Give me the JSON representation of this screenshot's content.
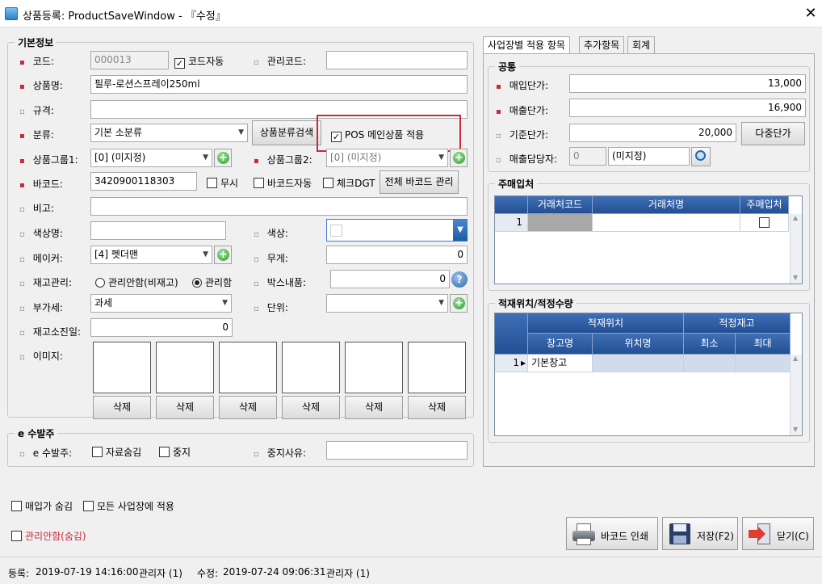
{
  "window": {
    "title": "상품등록: ProductSaveWindow - 『수정』"
  },
  "basic": {
    "legend": "기본정보",
    "code_label": "코드:",
    "code_value": "000013",
    "code_auto": "코드자동",
    "mgmt_code_label": "관리코드:",
    "mgmt_code_value": "",
    "name_label": "상품명:",
    "name_value": "필루-로션스프레이250ml",
    "spec_label": "규격:",
    "spec_value": "",
    "class_label": "분류:",
    "class_value": "기본 소분류",
    "class_search": "상품분류검색",
    "pos_main": "POS 메인상품 적용",
    "group1_label": "상품그룹1:",
    "group1_value": "[0] (미지정)",
    "group2_label": "상품그룹2:",
    "group2_value": "[0] (미지정)",
    "barcode_label": "바코드:",
    "barcode_value": "3420900118303",
    "ignore": "무시",
    "barcode_auto": "바코드자동",
    "check_dgt": "체크DGT",
    "barcode_manage": "전체 바코드 관리",
    "note_label": "비고:",
    "note_value": "",
    "color_name_label": "색상명:",
    "color_name_value": "",
    "color_label": "색상:",
    "maker_label": "메이커:",
    "maker_value": "[4] 펫더맨",
    "weight_label": "무게:",
    "weight_value": "0",
    "stock_label": "재고관리:",
    "stock_opt1": "관리안함(비재고)",
    "stock_opt2": "관리함",
    "box_label": "박스내품:",
    "box_value": "0",
    "vat_label": "부가세:",
    "vat_value": "과세",
    "unit_label": "단위:",
    "unit_value": "",
    "stockout_label": "재고소진일:",
    "stockout_value": "0",
    "image_label": "이미지:",
    "delete_buttons": [
      "삭제",
      "삭제",
      "삭제",
      "삭제",
      "삭제",
      "삭제"
    ]
  },
  "eorder": {
    "legend": "e 수발주",
    "label": "e 수발주:",
    "hide": "자료숨김",
    "stop": "중지",
    "stop_reason_label": "중지사유:",
    "stop_reason_value": ""
  },
  "bottom": {
    "hide_buy": "매입가 숨김",
    "apply_all": "모든 사업장에 적용",
    "no_manage": "관리안함(숨김)"
  },
  "tabs": [
    "사업장별 적용 항목",
    "추가항목",
    "회계"
  ],
  "common": {
    "legend": "공통",
    "buy_label": "매입단가:",
    "buy_value": "13,000",
    "sell_label": "매출단가:",
    "sell_value": "16,900",
    "base_label": "기준단가:",
    "base_value": "20,000",
    "multi_price": "다중단가",
    "manager_label": "매출담당자:",
    "manager_code": "0",
    "manager_value": "(미지정)"
  },
  "supplier": {
    "legend": "주매입처",
    "headers": [
      "거래처코드",
      "거래처명",
      "주매입처"
    ],
    "rows": [
      {
        "no": "1",
        "code": "",
        "name": ""
      }
    ]
  },
  "location": {
    "legend": "적재위치/적정수량",
    "group_headers": [
      "적재위치",
      "적정재고"
    ],
    "headers": [
      "창고명",
      "위치명",
      "최소",
      "최대"
    ],
    "rows": [
      {
        "no": "1",
        "warehouse": "기본창고",
        "location": "",
        "min": "",
        "max": ""
      }
    ]
  },
  "actions": {
    "print_barcode": "바코드 인쇄",
    "save": "저장(F2)",
    "close": "닫기(C)"
  },
  "status": {
    "reg_label": "등록:",
    "reg_time": "2019-07-19 14:16:00",
    "reg_user": "관리자 (1)",
    "mod_label": "수정:",
    "mod_time": "2019-07-24 09:06:31",
    "mod_user": "관리자 (1)"
  }
}
